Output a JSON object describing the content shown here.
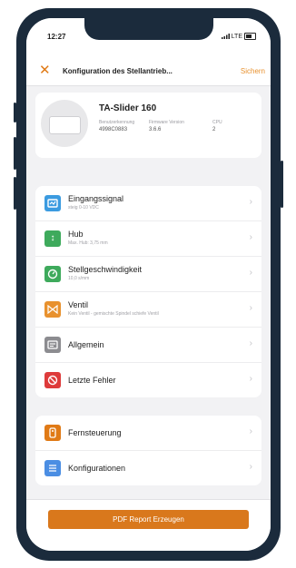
{
  "status_bar": {
    "time": "12:27",
    "network": "LTE"
  },
  "navbar": {
    "title": "Konfiguration des Stellantrieb...",
    "action_label": "Sichern"
  },
  "device": {
    "name": "TA-Slider 160",
    "fields": [
      {
        "label": "Benutzerkennung",
        "value": "4998C0883"
      },
      {
        "label": "Firmware Version",
        "value": "3.6.6"
      },
      {
        "label": "CPU",
        "value": "2"
      }
    ]
  },
  "settings": [
    {
      "label": "Eingangssignal",
      "subtitle": "steig 0-10 VDC",
      "icon": "signal-icon",
      "color": "#3b9be0"
    },
    {
      "label": "Hub",
      "subtitle": "Max. Hub: 3,75 mm",
      "icon": "stroke-icon",
      "color": "#3eaa5c"
    },
    {
      "label": "Stellgeschwindigkeit",
      "subtitle": "10,0 s/mm",
      "icon": "speed-icon",
      "color": "#3eaa5c"
    },
    {
      "label": "Ventil",
      "subtitle": "Kein Ventil - gemischte Spindel schiefe Ventil",
      "icon": "valve-icon",
      "color": "#e8912e"
    },
    {
      "label": "Allgemein",
      "subtitle": "",
      "icon": "general-icon",
      "color": "#8c8c90"
    },
    {
      "label": "Letzte Fehler",
      "subtitle": "",
      "icon": "error-icon",
      "color": "#de3b3b"
    }
  ],
  "tools": [
    {
      "label": "Fernsteuerung",
      "icon": "remote-icon",
      "color": "#e07a16"
    },
    {
      "label": "Konfigurationen",
      "icon": "configurations-icon",
      "color": "#4b8ee3"
    }
  ],
  "footer": {
    "report_button": "PDF Report Erzeugen"
  }
}
